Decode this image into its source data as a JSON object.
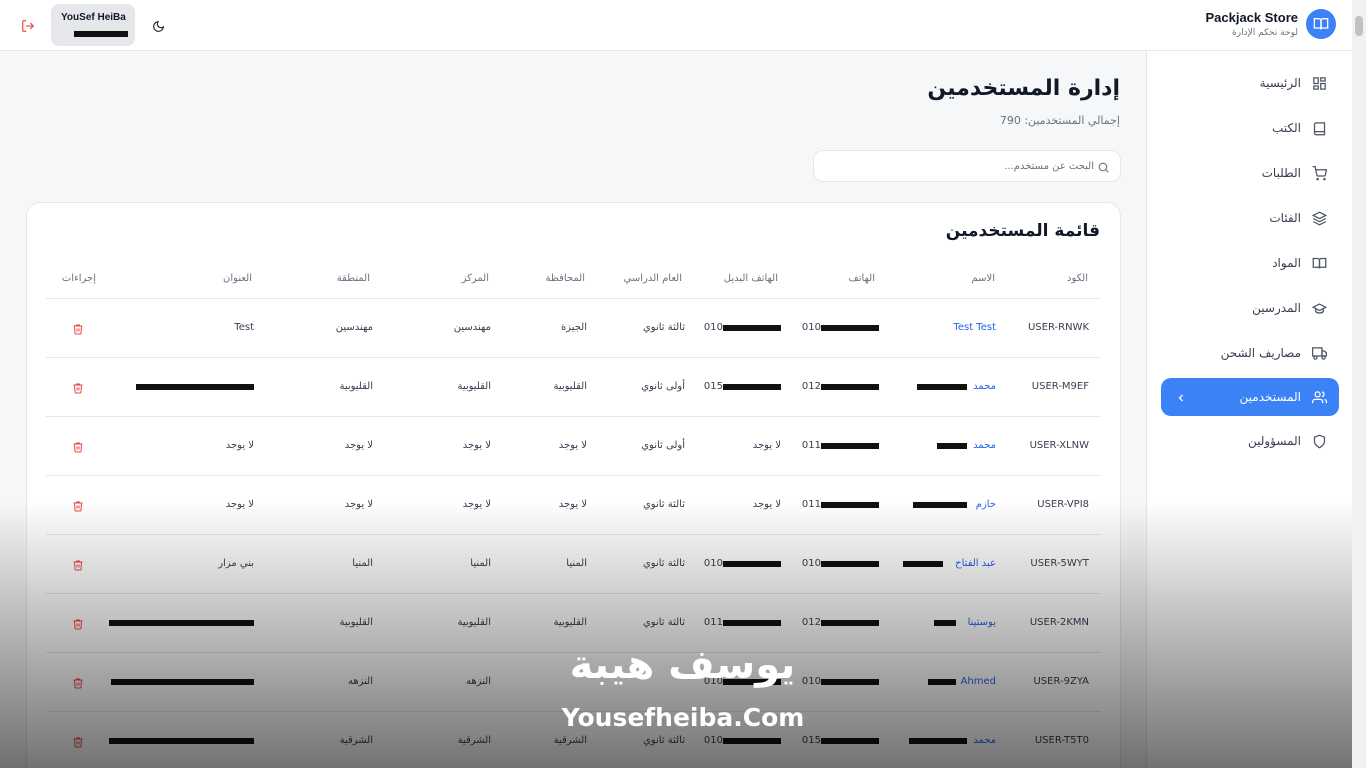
{
  "brand": {
    "name": "Packjack Store",
    "subtitle": "لوحة تحكم الإدارة"
  },
  "user": {
    "name": "YouSef HeiBa"
  },
  "sidebar": {
    "items": [
      {
        "label": "الرئيسية",
        "icon": "dashboard-icon"
      },
      {
        "label": "الكتب",
        "icon": "book-icon"
      },
      {
        "label": "الطلبات",
        "icon": "cart-icon"
      },
      {
        "label": "الفئات",
        "icon": "layers-icon"
      },
      {
        "label": "المواد",
        "icon": "open-book-icon"
      },
      {
        "label": "المدرسين",
        "icon": "graduation-cap-icon"
      },
      {
        "label": "مصاريف الشحن",
        "icon": "truck-icon"
      },
      {
        "label": "المستخدمين",
        "icon": "users-icon",
        "active": true
      },
      {
        "label": "المسؤولين",
        "icon": "shield-icon"
      }
    ]
  },
  "page": {
    "title": "إدارة المستخدمين",
    "total": "إجمالي المستخدمين: 790"
  },
  "search": {
    "placeholder": "البحث عن مستخدم..."
  },
  "table": {
    "title": "قائمة المستخدمين",
    "columns": {
      "code": "الكود",
      "name": "الاسم",
      "phone": "الهاتف",
      "alt_phone": "الهاتف البديل",
      "year": "العام الدراسي",
      "governorate": "المحافظة",
      "center": "المركز",
      "region": "المنطقة",
      "address": "العنوان",
      "actions": "إجراءات"
    },
    "rows": [
      {
        "code": "USER-RNWK",
        "name": "Test Test",
        "phone": "010",
        "alt_phone": "010",
        "year": "ثالثة ثانوي",
        "governorate": "الجيزة",
        "center": "مهندسين",
        "region": "مهندسين",
        "address": "Test"
      },
      {
        "code": "USER-M9EF",
        "name": "محمد",
        "phone": "012",
        "alt_phone": "015",
        "year": "أولى ثانوي",
        "governorate": "القليوبية",
        "center": "القليوبية",
        "region": "القليوبية",
        "address": ""
      },
      {
        "code": "USER-XLNW",
        "name": "محمد",
        "phone": "011",
        "alt_phone": "لا يوجد",
        "year": "أولى ثانوي",
        "governorate": "لا يوجد",
        "center": "لا يوجد",
        "region": "لا يوجد",
        "address": "لا يوجد"
      },
      {
        "code": "USER-VPI8",
        "name": "حازم",
        "phone": "011",
        "alt_phone": "لا يوجد",
        "year": "ثالثة ثانوي",
        "governorate": "لا يوجد",
        "center": "لا يوجد",
        "region": "لا يوجد",
        "address": "لا يوجد"
      },
      {
        "code": "USER-5WYT",
        "name": "عبد الفتاح",
        "phone": "010",
        "alt_phone": "010",
        "year": "ثالثة ثانوي",
        "governorate": "المنيا",
        "center": "المنيا",
        "region": "المنيا",
        "address": "بني مزار"
      },
      {
        "code": "USER-2KMN",
        "name": "يوستينا",
        "phone": "012",
        "alt_phone": "011",
        "year": "ثالثة ثانوي",
        "governorate": "القليوبية",
        "center": "القليوبية",
        "region": "القليوبية",
        "address": ""
      },
      {
        "code": "USER-9ZYA",
        "name": "Ahmed",
        "phone": "010",
        "alt_phone": "010",
        "year": "",
        "governorate": "",
        "center": "النزهه",
        "region": "النزهه",
        "address": ""
      },
      {
        "code": "USER-T5T0",
        "name": "محمد",
        "phone": "015",
        "alt_phone": "010",
        "year": "ثالثة ثانوي",
        "governorate": "الشرقية",
        "center": "الشرقية",
        "region": "الشرقية",
        "address": ""
      }
    ]
  },
  "watermark": {
    "arabic": "يوسف هيبة",
    "latin": "Yousefheiba.Com"
  },
  "colors": {
    "accent": "#3b82f6",
    "link": "#2563eb",
    "danger": "#ef4444"
  }
}
